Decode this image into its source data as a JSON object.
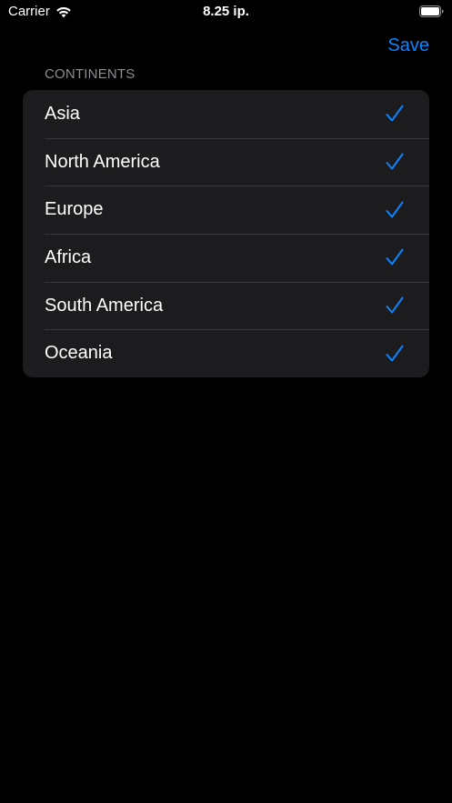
{
  "status_bar": {
    "carrier": "Carrier",
    "time": "8.25 ip.",
    "wifi_icon": "wifi-icon",
    "battery_icon": "battery-icon"
  },
  "nav_bar": {
    "save_label": "Save"
  },
  "section": {
    "header": "CONTINENTS",
    "items": [
      {
        "label": "Asia",
        "checked": true,
        "icon": "checkmark-icon"
      },
      {
        "label": "North America",
        "checked": true,
        "icon": "checkmark-icon"
      },
      {
        "label": "Europe",
        "checked": true,
        "icon": "checkmark-icon"
      },
      {
        "label": "Africa",
        "checked": true,
        "icon": "checkmark-icon"
      },
      {
        "label": "South America",
        "checked": true,
        "icon": "checkmark-icon"
      },
      {
        "label": "Oceania",
        "checked": true,
        "icon": "checkmark-icon"
      }
    ]
  },
  "colors": {
    "background": "#000000",
    "cell_background": "#1c1c1e",
    "separator": "#38383a",
    "accent": "#0a84ff",
    "secondary_text": "#8d8d93",
    "primary_text": "#ffffff"
  }
}
